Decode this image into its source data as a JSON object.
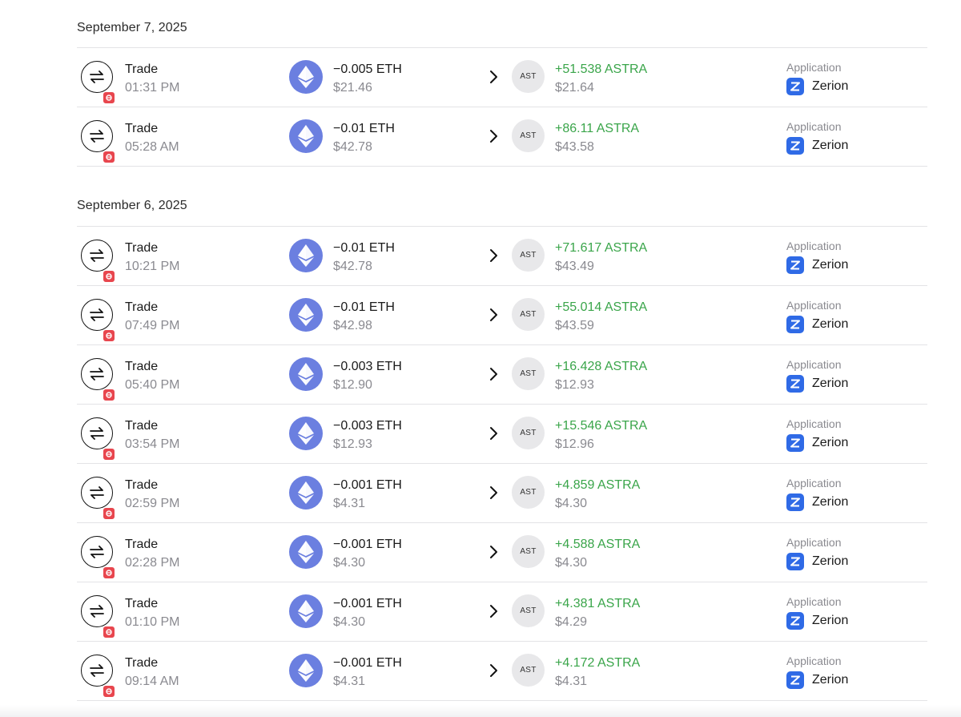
{
  "groups": [
    {
      "date": "September 7, 2025",
      "rows": [
        {
          "type": "Trade",
          "time": "01:31 PM",
          "sent_amount": "−0.005 ETH",
          "sent_usd": "$21.46",
          "recv_token": "AST",
          "recv_amount": "+51.538 ASTRA",
          "recv_usd": "$21.64",
          "app_label": "Application",
          "app_name": "Zerion"
        },
        {
          "type": "Trade",
          "time": "05:28 AM",
          "sent_amount": "−0.01 ETH",
          "sent_usd": "$42.78",
          "recv_token": "AST",
          "recv_amount": "+86.11 ASTRA",
          "recv_usd": "$43.58",
          "app_label": "Application",
          "app_name": "Zerion"
        }
      ]
    },
    {
      "date": "September 6, 2025",
      "rows": [
        {
          "type": "Trade",
          "time": "10:21 PM",
          "sent_amount": "−0.01 ETH",
          "sent_usd": "$42.78",
          "recv_token": "AST",
          "recv_amount": "+71.617 ASTRA",
          "recv_usd": "$43.49",
          "app_label": "Application",
          "app_name": "Zerion"
        },
        {
          "type": "Trade",
          "time": "07:49 PM",
          "sent_amount": "−0.01 ETH",
          "sent_usd": "$42.98",
          "recv_token": "AST",
          "recv_amount": "+55.014 ASTRA",
          "recv_usd": "$43.59",
          "app_label": "Application",
          "app_name": "Zerion"
        },
        {
          "type": "Trade",
          "time": "05:40 PM",
          "sent_amount": "−0.003 ETH",
          "sent_usd": "$12.90",
          "recv_token": "AST",
          "recv_amount": "+16.428 ASTRA",
          "recv_usd": "$12.93",
          "app_label": "Application",
          "app_name": "Zerion"
        },
        {
          "type": "Trade",
          "time": "03:54 PM",
          "sent_amount": "−0.003 ETH",
          "sent_usd": "$12.93",
          "recv_token": "AST",
          "recv_amount": "+15.546 ASTRA",
          "recv_usd": "$12.96",
          "app_label": "Application",
          "app_name": "Zerion"
        },
        {
          "type": "Trade",
          "time": "02:59 PM",
          "sent_amount": "−0.001 ETH",
          "sent_usd": "$4.31",
          "recv_token": "AST",
          "recv_amount": "+4.859 ASTRA",
          "recv_usd": "$4.30",
          "app_label": "Application",
          "app_name": "Zerion"
        },
        {
          "type": "Trade",
          "time": "02:28 PM",
          "sent_amount": "−0.001 ETH",
          "sent_usd": "$4.30",
          "recv_token": "AST",
          "recv_amount": "+4.588 ASTRA",
          "recv_usd": "$4.30",
          "app_label": "Application",
          "app_name": "Zerion"
        },
        {
          "type": "Trade",
          "time": "01:10 PM",
          "sent_amount": "−0.001 ETH",
          "sent_usd": "$4.30",
          "recv_token": "AST",
          "recv_amount": "+4.381 ASTRA",
          "recv_usd": "$4.29",
          "app_label": "Application",
          "app_name": "Zerion"
        },
        {
          "type": "Trade",
          "time": "09:14 AM",
          "sent_amount": "−0.001 ETH",
          "sent_usd": "$4.31",
          "recv_token": "AST",
          "recv_amount": "+4.172 ASTRA",
          "recv_usd": "$4.31",
          "app_label": "Application",
          "app_name": "Zerion"
        }
      ]
    }
  ],
  "icons": {
    "trade": "swap-arrows-icon",
    "trade_badge": "zerion-badge-icon",
    "sent_token": "ethereum-icon",
    "direction": "chevron-right-icon",
    "app": "zerion-icon"
  },
  "colors": {
    "positive": "#3aa54a",
    "muted": "#8a8a90",
    "eth": "#6b7fe0",
    "zerion": "#2f6ae6",
    "badge": "#e8464e"
  }
}
